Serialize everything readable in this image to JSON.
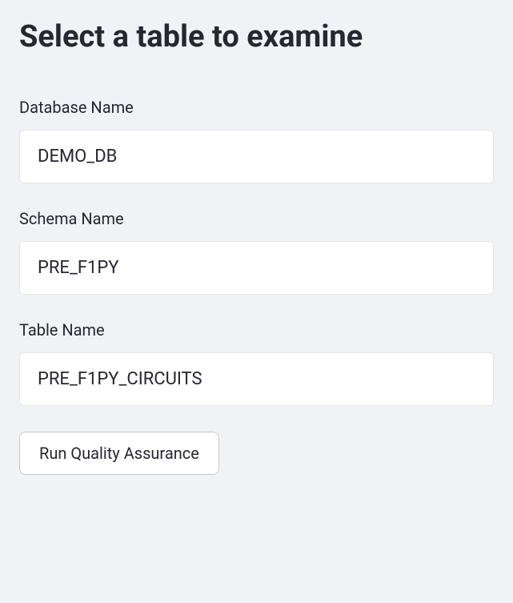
{
  "header": {
    "title": "Select a table to examine"
  },
  "form": {
    "database": {
      "label": "Database Name",
      "value": "DEMO_DB"
    },
    "schema": {
      "label": "Schema Name",
      "value": "PRE_F1PY"
    },
    "table": {
      "label": "Table Name",
      "value": "PRE_F1PY_CIRCUITS"
    },
    "submit": {
      "label": "Run Quality Assurance"
    }
  }
}
